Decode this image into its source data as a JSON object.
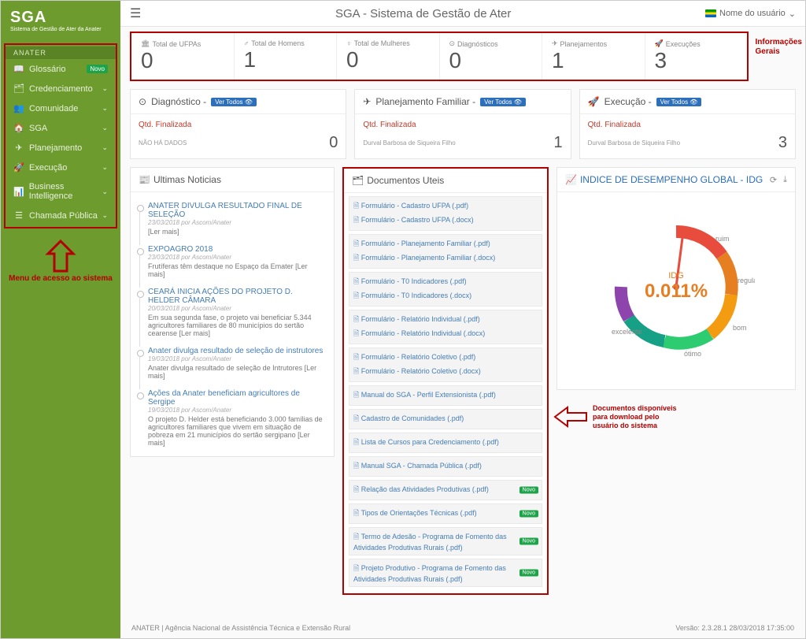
{
  "app": {
    "title": "SGA - Sistema de Gestão de Ater",
    "logo": "SGA",
    "logo_sub": "Sistema de Gestão de Ater da Anater"
  },
  "user": {
    "label": "Nome do usuário"
  },
  "sidebar": {
    "category": "ANATER",
    "items": [
      {
        "icon": "📖",
        "label": "Glossário",
        "badge": "Novo"
      },
      {
        "icon": "🗂",
        "label": "Credenciamento",
        "expand": true
      },
      {
        "icon": "👥",
        "label": "Comunidade",
        "expand": true
      },
      {
        "icon": "🏠",
        "label": "SGA",
        "expand": true
      },
      {
        "icon": "✈",
        "label": "Planejamento",
        "expand": true
      },
      {
        "icon": "🚀",
        "label": "Execução",
        "expand": true
      },
      {
        "icon": "📊",
        "label": "Business Intelligence",
        "expand": true
      },
      {
        "icon": "☰",
        "label": "Chamada Pública",
        "expand": true
      }
    ],
    "caption": "Menu de acesso ao sistema"
  },
  "stats": {
    "items": [
      {
        "icon": "🏛",
        "label": "Total de UFPAs",
        "value": "0"
      },
      {
        "icon": "♂",
        "label": "Total de Homens",
        "value": "1"
      },
      {
        "icon": "♀",
        "label": "Total de Mulheres",
        "value": "0"
      },
      {
        "icon": "⊙",
        "label": "Diagnósticos",
        "value": "0"
      },
      {
        "icon": "✈",
        "label": "Planejamentos",
        "value": "1"
      },
      {
        "icon": "🚀",
        "label": "Execuções",
        "value": "3"
      }
    ],
    "caption1": "Informações",
    "caption2": "Gerais"
  },
  "panels": {
    "diag": {
      "title": "Diagnóstico -",
      "pill": "Ver Todos 👁",
      "sub": "Qtd. Finalizada",
      "name": "NÃO HÁ DADOS",
      "value": "0"
    },
    "plan": {
      "title": "Planejamento Familiar -",
      "pill": "Ver Todos 👁",
      "sub": "Qtd. Finalizada",
      "name": "Durval Barbosa de Siqueira Filho",
      "value": "1"
    },
    "exec": {
      "title": "Execução -",
      "pill": "Ver Todos 👁",
      "sub": "Qtd. Finalizada",
      "name": "Durval Barbosa de Siqueira Filho",
      "value": "3"
    }
  },
  "news": {
    "header": "Ultimas Noticias",
    "items": [
      {
        "title": "ANATER DIVULGA RESULTADO FINAL DE SELEÇÃO",
        "meta": "23/03/2018 por Ascom/Anater",
        "desc": "[Ler mais]"
      },
      {
        "title": "EXPOAGRO 2018",
        "meta": "23/03/2018 por Ascom/Anater",
        "desc": "Frutíferas têm destaque no Espaço da Emater [Ler mais]"
      },
      {
        "title": "CEARÁ INICIA AÇÕES DO PROJETO D. HELDER CÂMARA",
        "meta": "20/03/2018 por Ascom/Anater",
        "desc": "Em sua segunda fase, o projeto vai beneficiar 5.344 agricultores familiares de 80 municípios do sertão cearense [Ler mais]"
      },
      {
        "title": "Anater divulga resultado de seleção de instrutores",
        "meta": "19/03/2018 por Ascom/Anater",
        "desc": "Anater divulga resultado de seleção de Intrutores [Ler mais]"
      },
      {
        "title": "Ações da Anater beneficiam agricultores de Sergipe",
        "meta": "19/03/2018 por Ascom/Anater",
        "desc": "O projeto D. Helder está beneficiando 3.000 famílias de agricultores familiares que vivem em situação de pobreza em 21 municípios do sertão sergipano [Ler mais]"
      }
    ]
  },
  "docs": {
    "header": "Documentos Uteis",
    "groups": [
      {
        "lines": [
          "Formulário - Cadastro UFPA (.pdf)",
          "Formulário - Cadastro UFPA (.docx)"
        ]
      },
      {
        "lines": [
          "Formulário - Planejamento Familiar (.pdf)",
          "Formulário - Planejamento Familiar (.docx)"
        ]
      },
      {
        "lines": [
          "Formulário - T0 Indicadores (.pdf)",
          "Formulário - T0 Indicadores (.docx)"
        ]
      },
      {
        "lines": [
          "Formulário - Relatório Individual (.pdf)",
          "Formulário - Relatório Individual (.docx)"
        ]
      },
      {
        "lines": [
          "Formulário - Relatório Coletivo (.pdf)",
          "Formulário - Relatório Coletivo (.docx)"
        ]
      },
      {
        "lines": [
          "Manual do SGA - Perfil Extensionista (.pdf)"
        ]
      },
      {
        "lines": [
          "Cadastro de Comunidades (.pdf)"
        ]
      },
      {
        "lines": [
          "Lista de Cursos para Credenciamento (.pdf)"
        ]
      },
      {
        "lines": [
          "Manual SGA - Chamada Pública (.pdf)"
        ]
      },
      {
        "lines": [
          "Relação das Atividades Produtivas (.pdf)"
        ],
        "badge": "Novo"
      },
      {
        "lines": [
          "Tipos de Orientações Técnicas (.pdf)"
        ],
        "badge": "Novo"
      },
      {
        "lines": [
          "Termo de Adesão - Programa de Fomento das Atividades Produtivas Rurais (.pdf)"
        ],
        "badge": "Novo"
      },
      {
        "lines": [
          "Projeto Produtivo - Programa de Fomento das Atividades Produtivas Rurais (.pdf)"
        ],
        "badge": "Novo"
      }
    ],
    "caption": "Documentos disponíveis para download pelo usuário do sistema"
  },
  "idg": {
    "header": "INDICE DE DESEMPENHO GLOBAL - IDG",
    "label": "IDG",
    "value": "0.011%",
    "ticks": {
      "ruim": "ruim",
      "regular": "regular",
      "bom": "bom",
      "otimo": "ótimo",
      "excelente": "excelente"
    }
  },
  "footer": {
    "left": "ANATER | Agência Nacional de Assistência Técnica e Extensão Rural",
    "right": "Versão: 2.3.28.1 28/03/2018 17:35:00"
  }
}
